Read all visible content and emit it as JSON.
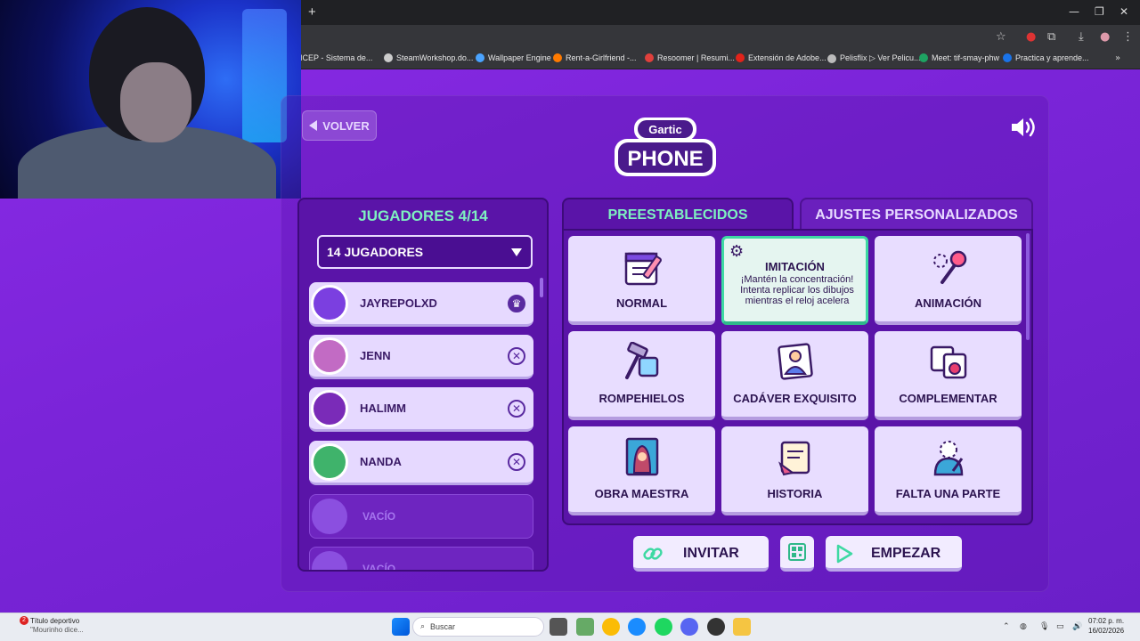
{
  "browser": {
    "bookmarks": [
      {
        "label": "SICEP - Sistema de...",
        "color": "#888888"
      },
      {
        "label": "SteamWorkshop.do...",
        "color": "#cccccc"
      },
      {
        "label": "Wallpaper Engine",
        "color": "#4aa3ff"
      },
      {
        "label": "Rent-a-Girlfriend -...",
        "color": "#ff7a00"
      },
      {
        "label": "Resoomer | Resumi...",
        "color": "#e0403c"
      },
      {
        "label": "Extensión de Adobe...",
        "color": "#e2231a"
      },
      {
        "label": "Pelisflix ▷ Ver Pelicu...",
        "color": "#bbbbbb"
      },
      {
        "label": "Meet: tif-smay-phw",
        "color": "#1ea362"
      },
      {
        "label": "Practica y aprende...",
        "color": "#1a73e8"
      }
    ]
  },
  "game": {
    "back_label": "VOLVER",
    "logo_top": "Gartic",
    "logo_bottom": "PHONE",
    "players_title": "JUGADORES 4/14",
    "players_select": "14 JUGADORES",
    "players": [
      {
        "name": "JAYREPOLXD",
        "action": "♛",
        "color": "#7b3fe0"
      },
      {
        "name": "JENN",
        "action": "✕",
        "color": "#c26bc4"
      },
      {
        "name": "HALIMM",
        "action": "✕",
        "color": "#7a2bb8"
      },
      {
        "name": "NANDA",
        "action": "✕",
        "color": "#3fb36b"
      }
    ],
    "empty_slots": [
      "VACÍO",
      "VACÍO"
    ],
    "tabs": {
      "presets": "PREESTABLECIDOS",
      "custom": "AJUSTES PERSONALIZADOS"
    },
    "modes": [
      {
        "label": "NORMAL",
        "icon": "notepad-pencil-icon"
      },
      {
        "label": "IMITACIÓN",
        "icon": "gear-icon",
        "selected": true,
        "description": "¡Mantén la concentración! Intenta replicar los dibujos mientras el reloj acelera"
      },
      {
        "label": "ANIMACIÓN",
        "icon": "pin-icon"
      },
      {
        "label": "ROMPEHIELOS",
        "icon": "hammer-ice-icon"
      },
      {
        "label": "CADÁVER EXQUISITO",
        "icon": "person-card-icon"
      },
      {
        "label": "COMPLEMENTAR",
        "icon": "puzzle-icon"
      },
      {
        "label": "OBRA MAESTRA",
        "icon": "portrait-icon"
      },
      {
        "label": "HISTORIA",
        "icon": "scroll-icon"
      },
      {
        "label": "FALTA UNA PARTE",
        "icon": "missing-part-icon"
      }
    ],
    "invite_label": "INVITAR",
    "start_label": "EMPEZAR"
  },
  "taskbar": {
    "news_title": "Título deportivo",
    "news_subtitle": "\"Mourinho dice...",
    "news_badge": "2",
    "search_placeholder": "Buscar",
    "time": "07:02 p. m.",
    "date": "16/02/2026"
  }
}
